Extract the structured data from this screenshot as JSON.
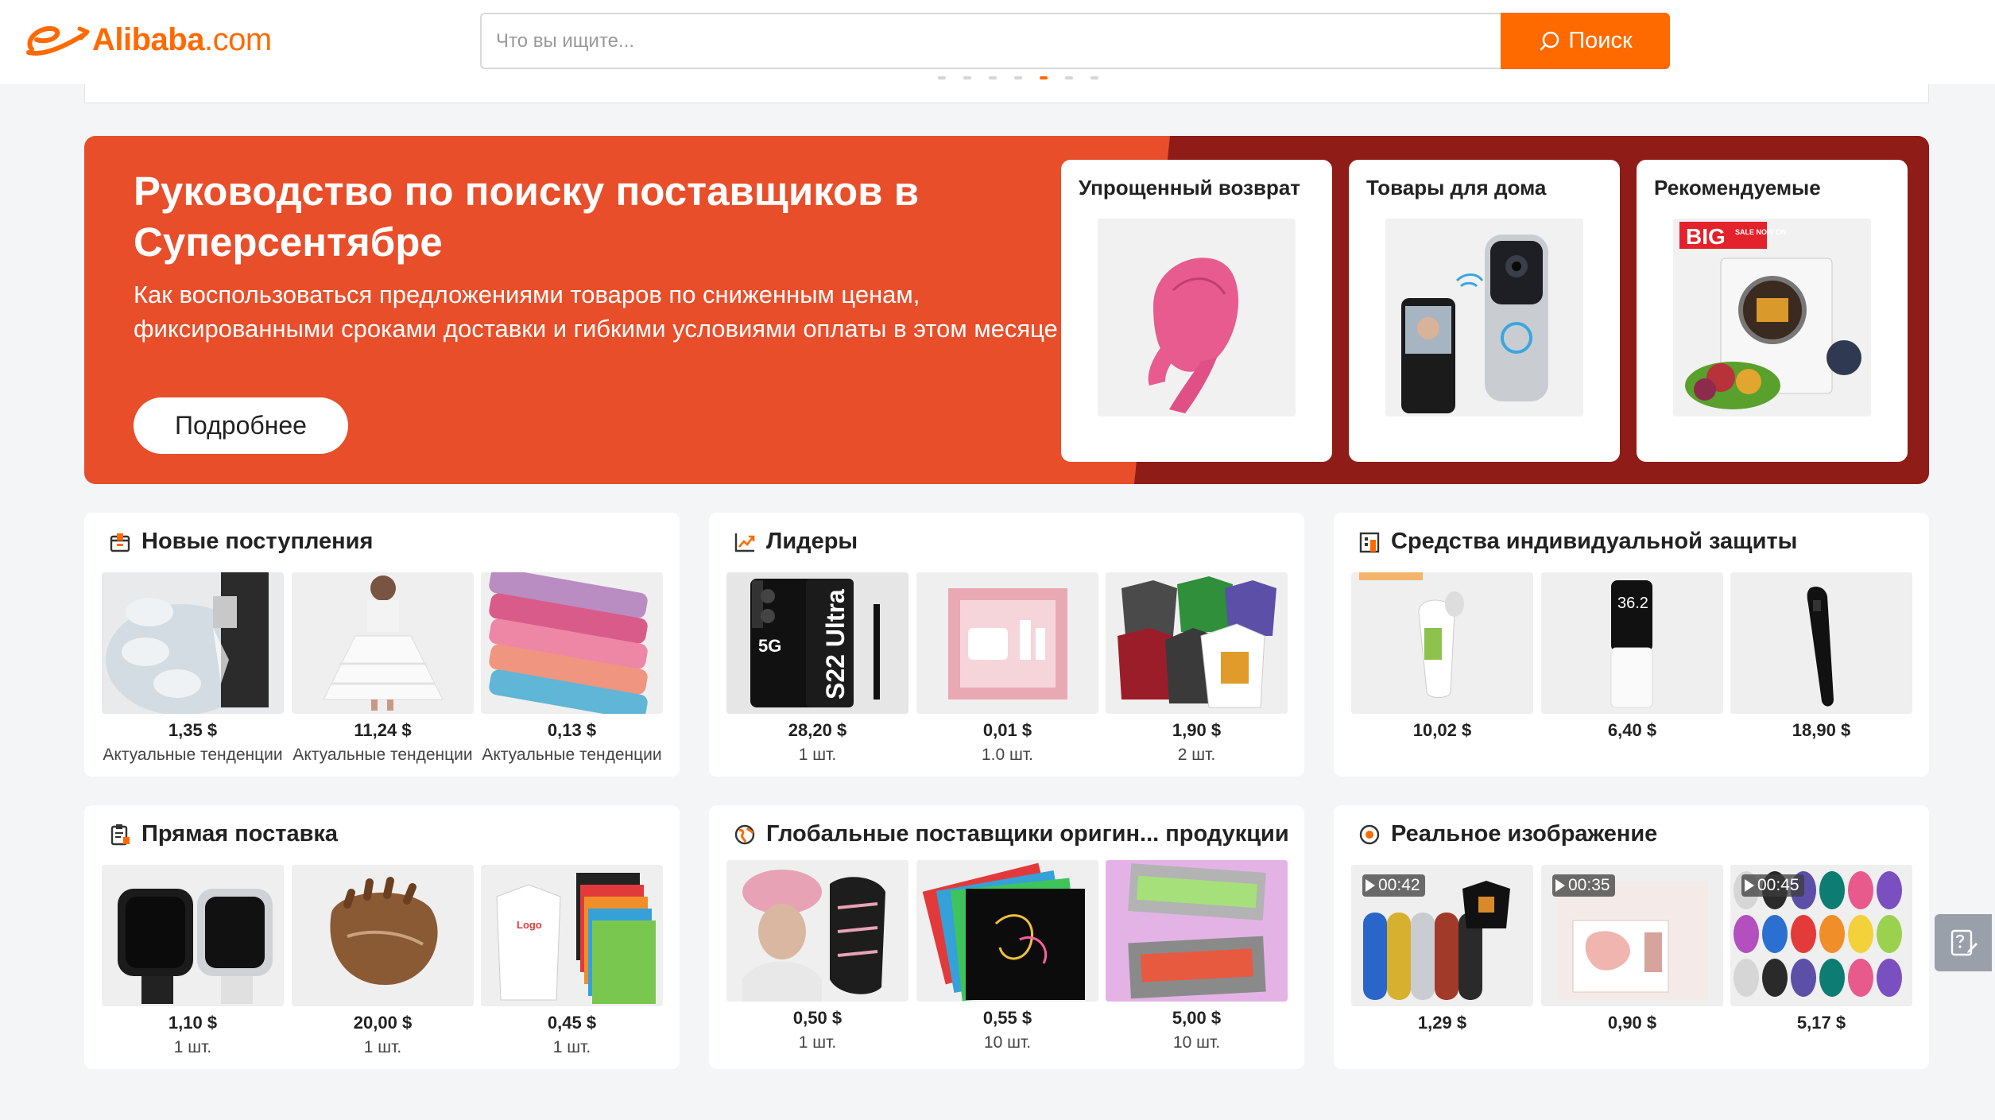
{
  "header": {
    "logo_text": "Alibaba",
    "logo_suffix": ".com",
    "search_placeholder": "Что вы ищите...",
    "search_button": "Поиск"
  },
  "banner": {
    "title": "Руководство по поиску поставщиков в Суперсентябре",
    "subtitle": "Как воспользоваться предложениями товаров по сниженным ценам, фиксированными сроками доставки и гибкими условиями оплаты в этом месяце",
    "button": "Подробнее",
    "promos": [
      {
        "title": "Упрощенный возврат"
      },
      {
        "title": "Товары для дома"
      },
      {
        "title": "Рекомендуемые",
        "badge": "BIG",
        "badge_small": "SALE NOW ON"
      }
    ]
  },
  "cards": [
    {
      "title": "Новые поступления",
      "products": [
        {
          "price": "1,35 $",
          "sub": "Актуальные тенденции"
        },
        {
          "price": "11,24 $",
          "sub": "Актуальные тенденции"
        },
        {
          "price": "0,13 $",
          "sub": "Актуальные тенденции"
        }
      ]
    },
    {
      "title": "Лидеры",
      "products": [
        {
          "price": "28,20 $",
          "sub": "1 шт.",
          "img_text_1": "5G",
          "img_text_2": "S22 Ultra"
        },
        {
          "price": "0,01 $",
          "sub": "1.0 шт."
        },
        {
          "price": "1,90 $",
          "sub": "2 шт."
        }
      ]
    },
    {
      "title": "Средства индивидуальной защиты",
      "products": [
        {
          "price": "10,02 $"
        },
        {
          "price": "6,40 $",
          "img_text": "36.2"
        },
        {
          "price": "18,90 $"
        }
      ]
    },
    {
      "title": "Прямая поставка",
      "products": [
        {
          "price": "1,10 $",
          "sub": "1 шт."
        },
        {
          "price": "20,00 $",
          "sub": "1 шт."
        },
        {
          "price": "0,45 $",
          "sub": "1 шт.",
          "img_text": "Logo"
        }
      ]
    },
    {
      "title": "Глобальные поставщики оригин... продукции",
      "products": [
        {
          "price": "0,50 $",
          "sub": "1 шт."
        },
        {
          "price": "0,55 $",
          "sub": "10 шт."
        },
        {
          "price": "5,00 $",
          "sub": "10 шт."
        }
      ]
    },
    {
      "title": "Реальное изображение",
      "products": [
        {
          "price": "1,29 $",
          "video": "00:42"
        },
        {
          "price": "0,90 $",
          "video": "00:35"
        },
        {
          "price": "5,17 $",
          "video": "00:45"
        }
      ]
    }
  ],
  "colors": {
    "accent": "#ff6a00",
    "banner": "#e84e2a",
    "banner_dark": "#8f1c16"
  },
  "icons": [
    "box-icon",
    "trend-up-icon",
    "building-icon",
    "clipboard-icon",
    "globe-icon",
    "camera-target-icon",
    "help-edit-icon",
    "search-icon"
  ]
}
